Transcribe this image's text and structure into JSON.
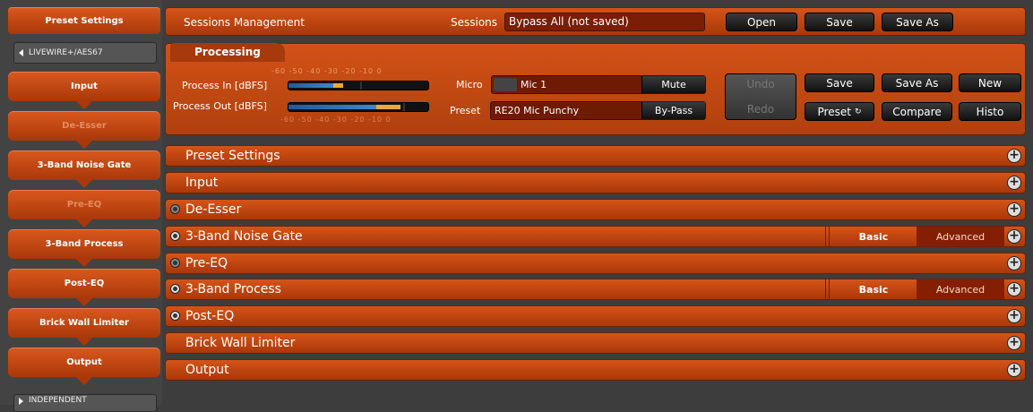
{
  "sidebar": {
    "top_item": "Preset Settings",
    "group_top": "LIVEWIRE+/AES67",
    "group_bottom": "INDEPENDENT",
    "items": [
      {
        "label": "Input",
        "enabled": true
      },
      {
        "label": "De-Esser",
        "enabled": false
      },
      {
        "label": "3-Band Noise Gate",
        "enabled": true
      },
      {
        "label": "Pre-EQ",
        "enabled": false
      },
      {
        "label": "3-Band Process",
        "enabled": true
      },
      {
        "label": "Post-EQ",
        "enabled": true
      },
      {
        "label": "Brick Wall Limiter",
        "enabled": true
      },
      {
        "label": "Output",
        "enabled": true
      }
    ]
  },
  "sessions": {
    "title": "Sessions Management",
    "label": "Sessions",
    "value": "Bypass All (not saved)",
    "open": "Open",
    "save": "Save",
    "save_as": "Save As"
  },
  "processing": {
    "tab": "Processing",
    "process_in_label": "Process In [dBFS]",
    "process_out_label": "Process Out [dBFS]",
    "scale": "-60 -50 -40 -30 -20 -10 0",
    "micro_label": "Micro",
    "micro_value": "Mic 1",
    "mute": "Mute",
    "preset_label": "Preset",
    "preset_value": "RE20 Mic Punchy",
    "bypass": "By-Pass",
    "undo": "Undo",
    "redo": "Redo",
    "save": "Save",
    "save_as": "Save As",
    "new": "New",
    "preset_btn": "Preset",
    "compare": "Compare",
    "histo": "Histo"
  },
  "sections": [
    {
      "label": "Preset Settings",
      "dot": "none"
    },
    {
      "label": "Input",
      "dot": "none"
    },
    {
      "label": "De-Esser",
      "dot": "off"
    },
    {
      "label": "3-Band Noise Gate",
      "dot": "on",
      "basic": "Basic",
      "advanced": "Advanced"
    },
    {
      "label": "Pre-EQ",
      "dot": "off"
    },
    {
      "label": "3-Band Process",
      "dot": "on",
      "basic": "Basic",
      "advanced": "Advanced"
    },
    {
      "label": "Post-EQ",
      "dot": "on"
    },
    {
      "label": "Brick Wall Limiter",
      "dot": "none"
    },
    {
      "label": "Output",
      "dot": "none"
    }
  ],
  "colors": {
    "accent": "#d55418",
    "accent_dark": "#a9380a",
    "background": "#3d3d3d"
  }
}
